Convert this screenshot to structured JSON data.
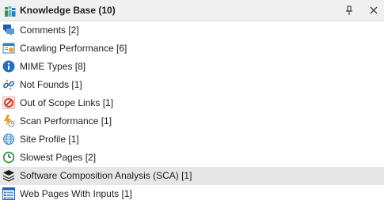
{
  "panel": {
    "title": "Knowledge Base (10)",
    "icon": "knowledge-base-books-icon",
    "pin_icon": "pin-icon",
    "close_icon": "close-icon"
  },
  "items": [
    {
      "label": "Comments [2]",
      "icon": "comments-icon"
    },
    {
      "label": "Crawling Performance [6]",
      "icon": "crawling-performance-icon"
    },
    {
      "label": "MIME Types [8]",
      "icon": "info-icon"
    },
    {
      "label": "Not Founds [1]",
      "icon": "broken-link-icon"
    },
    {
      "label": "Out of Scope Links [1]",
      "icon": "prohibited-icon"
    },
    {
      "label": "Scan Performance [1]",
      "icon": "lightning-clock-icon"
    },
    {
      "label": "Site Profile [1]",
      "icon": "globe-icon"
    },
    {
      "label": "Slowest Pages [2]",
      "icon": "clock-icon"
    },
    {
      "label": "Software Composition Analysis (SCA) [1]",
      "icon": "layers-icon"
    },
    {
      "label": "Web Pages With Inputs [1]",
      "icon": "form-list-icon"
    }
  ],
  "selected_index": 8,
  "colors": {
    "header_bg": "#f0f0f0",
    "selected_bg": "#e6e6e6",
    "accent_blue": "#1e73be",
    "green": "#2e9e3e",
    "red": "#d23b2e"
  }
}
